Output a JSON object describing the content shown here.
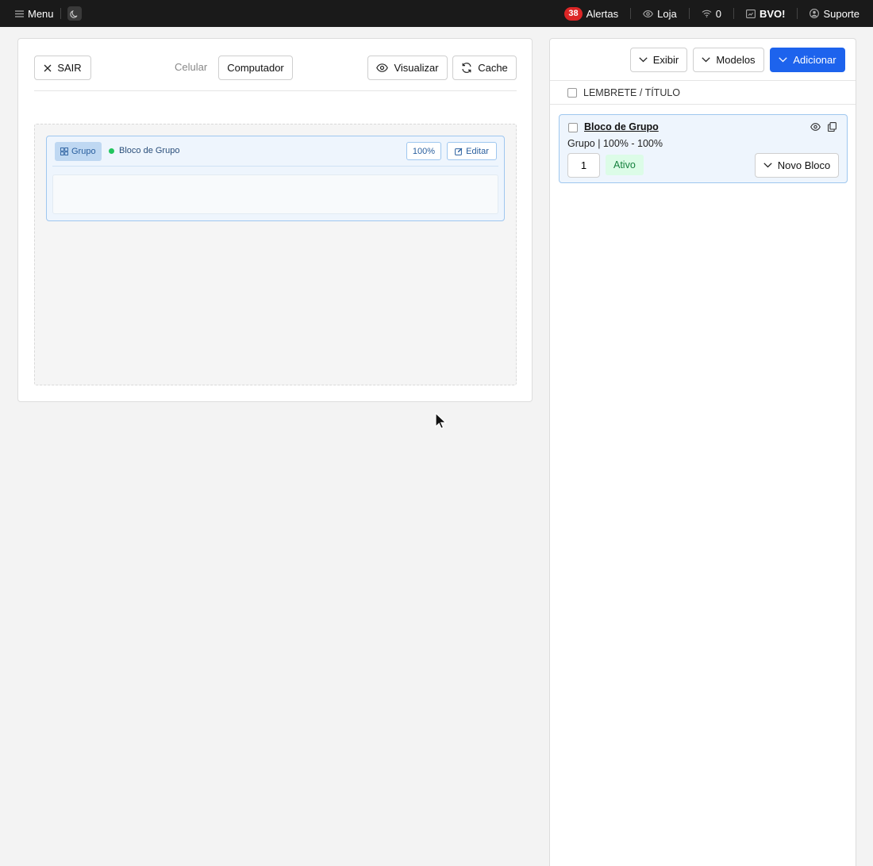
{
  "topbar": {
    "menu_label": "Menu",
    "alerts_count": "38",
    "alerts_label": "Alertas",
    "store_label": "Loja",
    "wifi_count": "0",
    "bvo_label": "BVO!",
    "support_label": "Suporte"
  },
  "editor": {
    "exit_label": "SAIR",
    "mobile_label": "Celular",
    "desktop_label": "Computador",
    "preview_label": "Visualizar",
    "cache_label": "Cache",
    "group": {
      "tag_label": "Grupo",
      "block_name": "Bloco de Grupo",
      "width_label": "100%",
      "edit_label": "Editar"
    }
  },
  "panel": {
    "show_label": "Exibir",
    "templates_label": "Modelos",
    "add_label": "Adicionar",
    "column_header": "LEMBRETE / TÍTULO",
    "item": {
      "title": "Bloco de Grupo",
      "subtitle": "Grupo | 100% - 100%",
      "order_value": "1",
      "status": "Ativo",
      "new_block_label": "Novo Bloco"
    }
  },
  "colors": {
    "primary": "#1d63ed",
    "alert_red": "#dc2626",
    "active_green": "#15803d",
    "topbar_bg": "#1a1a1a"
  }
}
